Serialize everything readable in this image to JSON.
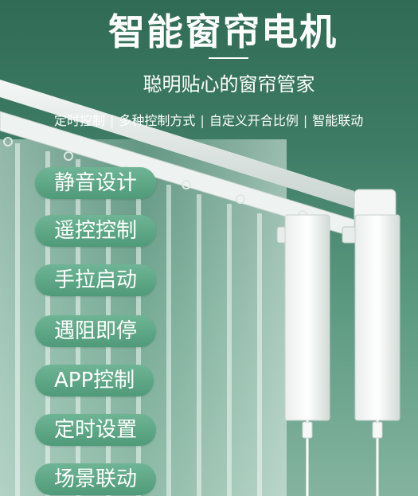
{
  "headline": {
    "title": "智能窗帘电机",
    "subtitle": "聪明贴心的窗帘管家"
  },
  "features_line": [
    "定时控制",
    "多种控制方式",
    "自定义开合比例",
    "智能联动"
  ],
  "feature_pills": [
    "静音设计",
    "遥控控制",
    "手拉启动",
    "遇阻即停",
    "APP控制",
    "定时设置",
    "场景联动"
  ],
  "colors": {
    "background_green": "#3f7c65",
    "pill_green": "#5aa684",
    "text": "#ffffff"
  }
}
